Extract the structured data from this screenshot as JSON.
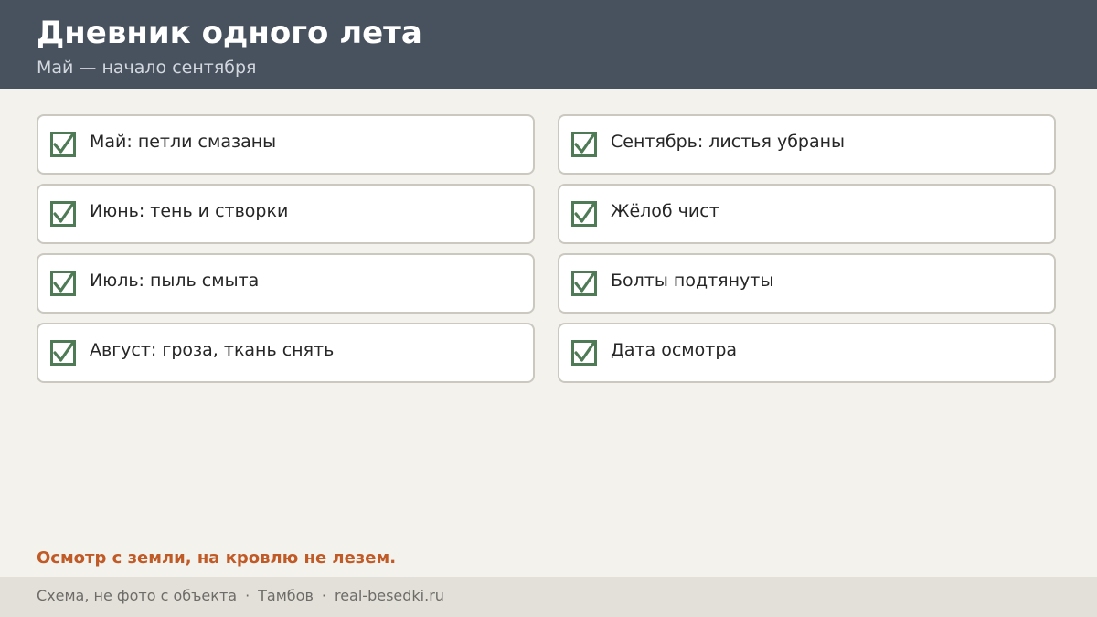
{
  "header": {
    "title": "Дневник одного лета",
    "subtitle": "Май — начало сентября"
  },
  "colors": {
    "header_bg": "#48525f",
    "check": "#4e7a55",
    "note": "#c05a26"
  },
  "checklist": {
    "left": [
      {
        "label": "Май: петли смазаны",
        "checked": true,
        "icon": "checkbox-checked-icon"
      },
      {
        "label": "Июнь: тень и створки",
        "checked": true,
        "icon": "checkbox-checked-icon"
      },
      {
        "label": "Июль: пыль смыта",
        "checked": true,
        "icon": "checkbox-checked-icon"
      },
      {
        "label": "Август: гроза, ткань снять",
        "checked": true,
        "icon": "checkbox-checked-icon"
      }
    ],
    "right": [
      {
        "label": "Сентябрь: листья убраны",
        "checked": true,
        "icon": "checkbox-checked-icon"
      },
      {
        "label": "Жёлоб чист",
        "checked": true,
        "icon": "checkbox-checked-icon"
      },
      {
        "label": "Болты подтянуты",
        "checked": true,
        "icon": "checkbox-checked-icon"
      },
      {
        "label": "Дата осмотра",
        "checked": true,
        "icon": "checkbox-checked-icon"
      }
    ]
  },
  "note": "Осмотр с земли, на кровлю не лезем.",
  "footer": {
    "caption": "Схема, не фото с объекта",
    "separator": "·",
    "city": "Тамбов",
    "site": "real-besedki.ru"
  }
}
